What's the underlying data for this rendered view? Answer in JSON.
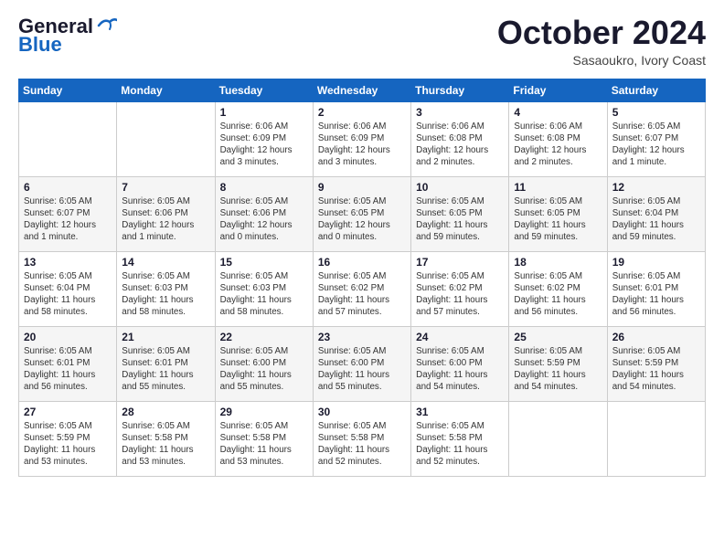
{
  "header": {
    "logo_line1": "General",
    "logo_line2": "Blue",
    "month": "October 2024",
    "location": "Sasaoukro, Ivory Coast"
  },
  "weekdays": [
    "Sunday",
    "Monday",
    "Tuesday",
    "Wednesday",
    "Thursday",
    "Friday",
    "Saturday"
  ],
  "weeks": [
    [
      {
        "day": "",
        "info": ""
      },
      {
        "day": "",
        "info": ""
      },
      {
        "day": "1",
        "info": "Sunrise: 6:06 AM\nSunset: 6:09 PM\nDaylight: 12 hours\nand 3 minutes."
      },
      {
        "day": "2",
        "info": "Sunrise: 6:06 AM\nSunset: 6:09 PM\nDaylight: 12 hours\nand 3 minutes."
      },
      {
        "day": "3",
        "info": "Sunrise: 6:06 AM\nSunset: 6:08 PM\nDaylight: 12 hours\nand 2 minutes."
      },
      {
        "day": "4",
        "info": "Sunrise: 6:06 AM\nSunset: 6:08 PM\nDaylight: 12 hours\nand 2 minutes."
      },
      {
        "day": "5",
        "info": "Sunrise: 6:05 AM\nSunset: 6:07 PM\nDaylight: 12 hours\nand 1 minute."
      }
    ],
    [
      {
        "day": "6",
        "info": "Sunrise: 6:05 AM\nSunset: 6:07 PM\nDaylight: 12 hours\nand 1 minute."
      },
      {
        "day": "7",
        "info": "Sunrise: 6:05 AM\nSunset: 6:06 PM\nDaylight: 12 hours\nand 1 minute."
      },
      {
        "day": "8",
        "info": "Sunrise: 6:05 AM\nSunset: 6:06 PM\nDaylight: 12 hours\nand 0 minutes."
      },
      {
        "day": "9",
        "info": "Sunrise: 6:05 AM\nSunset: 6:05 PM\nDaylight: 12 hours\nand 0 minutes."
      },
      {
        "day": "10",
        "info": "Sunrise: 6:05 AM\nSunset: 6:05 PM\nDaylight: 11 hours\nand 59 minutes."
      },
      {
        "day": "11",
        "info": "Sunrise: 6:05 AM\nSunset: 6:05 PM\nDaylight: 11 hours\nand 59 minutes."
      },
      {
        "day": "12",
        "info": "Sunrise: 6:05 AM\nSunset: 6:04 PM\nDaylight: 11 hours\nand 59 minutes."
      }
    ],
    [
      {
        "day": "13",
        "info": "Sunrise: 6:05 AM\nSunset: 6:04 PM\nDaylight: 11 hours\nand 58 minutes."
      },
      {
        "day": "14",
        "info": "Sunrise: 6:05 AM\nSunset: 6:03 PM\nDaylight: 11 hours\nand 58 minutes."
      },
      {
        "day": "15",
        "info": "Sunrise: 6:05 AM\nSunset: 6:03 PM\nDaylight: 11 hours\nand 58 minutes."
      },
      {
        "day": "16",
        "info": "Sunrise: 6:05 AM\nSunset: 6:02 PM\nDaylight: 11 hours\nand 57 minutes."
      },
      {
        "day": "17",
        "info": "Sunrise: 6:05 AM\nSunset: 6:02 PM\nDaylight: 11 hours\nand 57 minutes."
      },
      {
        "day": "18",
        "info": "Sunrise: 6:05 AM\nSunset: 6:02 PM\nDaylight: 11 hours\nand 56 minutes."
      },
      {
        "day": "19",
        "info": "Sunrise: 6:05 AM\nSunset: 6:01 PM\nDaylight: 11 hours\nand 56 minutes."
      }
    ],
    [
      {
        "day": "20",
        "info": "Sunrise: 6:05 AM\nSunset: 6:01 PM\nDaylight: 11 hours\nand 56 minutes."
      },
      {
        "day": "21",
        "info": "Sunrise: 6:05 AM\nSunset: 6:01 PM\nDaylight: 11 hours\nand 55 minutes."
      },
      {
        "day": "22",
        "info": "Sunrise: 6:05 AM\nSunset: 6:00 PM\nDaylight: 11 hours\nand 55 minutes."
      },
      {
        "day": "23",
        "info": "Sunrise: 6:05 AM\nSunset: 6:00 PM\nDaylight: 11 hours\nand 55 minutes."
      },
      {
        "day": "24",
        "info": "Sunrise: 6:05 AM\nSunset: 6:00 PM\nDaylight: 11 hours\nand 54 minutes."
      },
      {
        "day": "25",
        "info": "Sunrise: 6:05 AM\nSunset: 5:59 PM\nDaylight: 11 hours\nand 54 minutes."
      },
      {
        "day": "26",
        "info": "Sunrise: 6:05 AM\nSunset: 5:59 PM\nDaylight: 11 hours\nand 54 minutes."
      }
    ],
    [
      {
        "day": "27",
        "info": "Sunrise: 6:05 AM\nSunset: 5:59 PM\nDaylight: 11 hours\nand 53 minutes."
      },
      {
        "day": "28",
        "info": "Sunrise: 6:05 AM\nSunset: 5:58 PM\nDaylight: 11 hours\nand 53 minutes."
      },
      {
        "day": "29",
        "info": "Sunrise: 6:05 AM\nSunset: 5:58 PM\nDaylight: 11 hours\nand 53 minutes."
      },
      {
        "day": "30",
        "info": "Sunrise: 6:05 AM\nSunset: 5:58 PM\nDaylight: 11 hours\nand 52 minutes."
      },
      {
        "day": "31",
        "info": "Sunrise: 6:05 AM\nSunset: 5:58 PM\nDaylight: 11 hours\nand 52 minutes."
      },
      {
        "day": "",
        "info": ""
      },
      {
        "day": "",
        "info": ""
      }
    ]
  ]
}
